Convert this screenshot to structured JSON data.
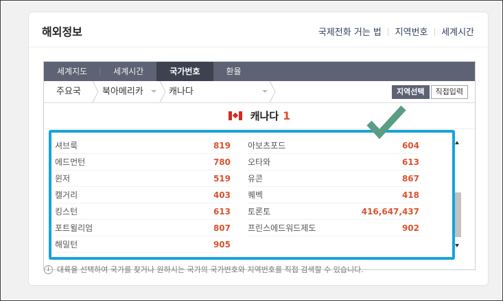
{
  "card": {
    "title": "해외정보",
    "links": [
      "국제전화 거는 법",
      "지역번호",
      "세계시간"
    ]
  },
  "tabs": [
    "세계지도",
    "세계시간",
    "국가번호",
    "환율"
  ],
  "active_tab": "국가번호",
  "breadcrumb": {
    "level1": "주요국",
    "level2": "북아메리카",
    "level3": "캐나다"
  },
  "mode_buttons": {
    "region_select": "지역선택",
    "direct_input": "직접입력"
  },
  "country": {
    "name": "캐나다",
    "code": "1"
  },
  "regions_left": [
    {
      "name": "셔브룩",
      "code": "819"
    },
    {
      "name": "에드먼턴",
      "code": "780"
    },
    {
      "name": "윈저",
      "code": "519"
    },
    {
      "name": "캘거리",
      "code": "403"
    },
    {
      "name": "킹스턴",
      "code": "613"
    },
    {
      "name": "포트윌리엄",
      "code": "807"
    },
    {
      "name": "해밀턴",
      "code": "905"
    }
  ],
  "regions_right": [
    {
      "name": "아보츠포드",
      "code": "604"
    },
    {
      "name": "오타와",
      "code": "613"
    },
    {
      "name": "유콘",
      "code": "867"
    },
    {
      "name": "퀘벡",
      "code": "418"
    },
    {
      "name": "토론토",
      "code": "416,647,437"
    },
    {
      "name": "프린스에드워드제도",
      "code": "902"
    }
  ],
  "notice": "대륙을 선택하여 국가를 찾거나 원하시는 국가의 국가번호와 지역번호를 직접 검색할 수 있습니다.",
  "colors": {
    "tab_bar": "#5d6274",
    "code_text": "#d9532f",
    "highlight_border": "#17a3dc",
    "checkmark": "#5a9c84"
  }
}
